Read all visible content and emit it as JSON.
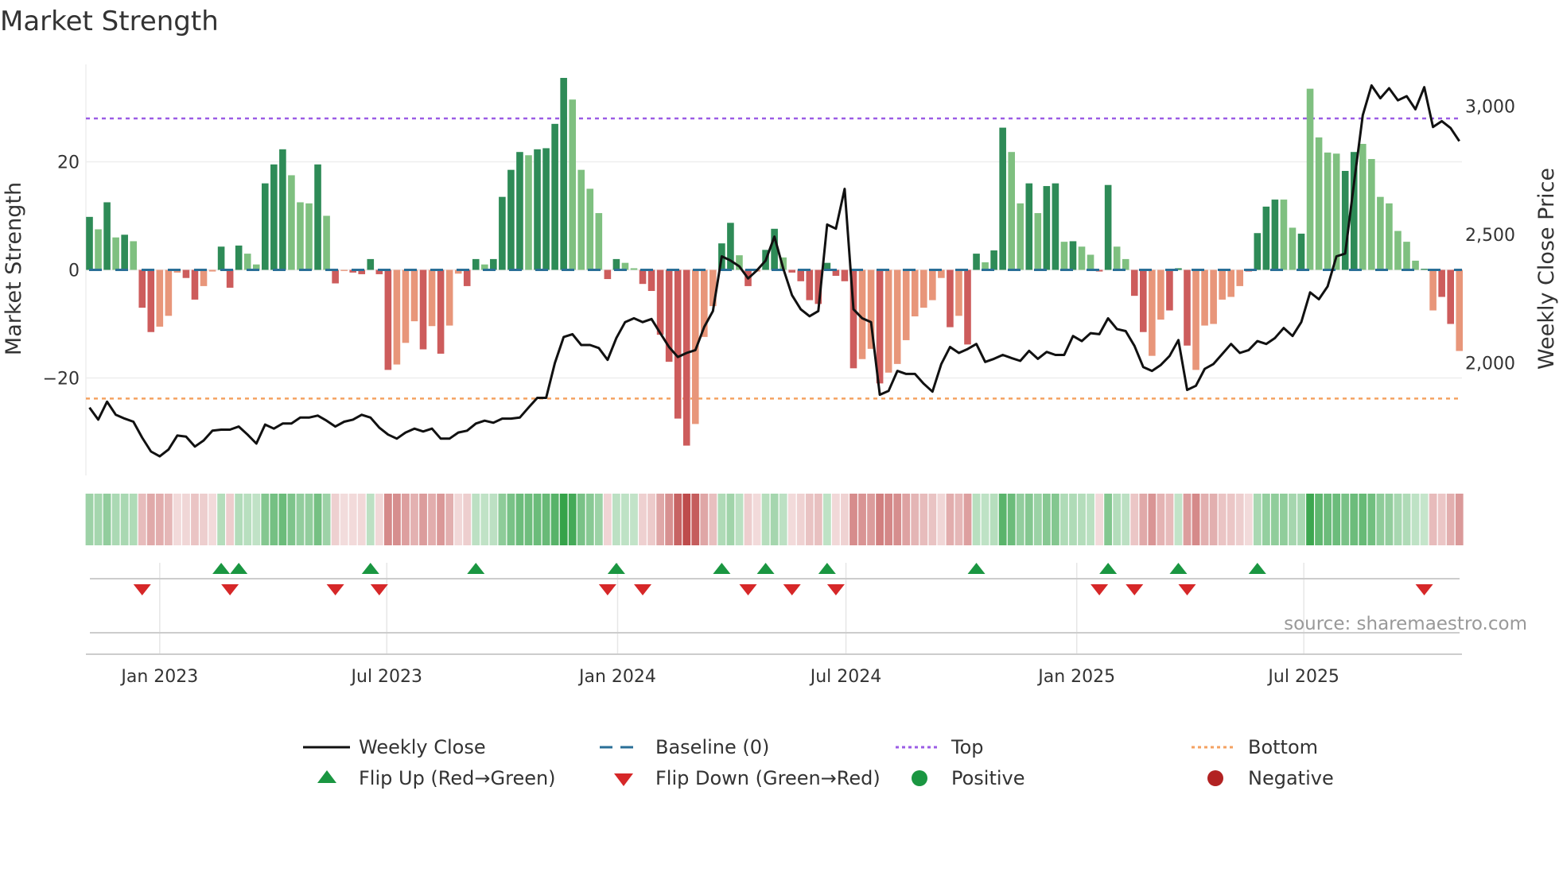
{
  "chart_data": {
    "type": "bar+line",
    "title": "Market Strength",
    "ylabel": "Market Strength",
    "y2label": "Weekly Close Price",
    "ylim": [
      -38,
      38
    ],
    "y2lim": [
      1562,
      3163
    ],
    "start_week": "2022-11-06",
    "frequency": "weekly",
    "yticks": [
      {
        "v": 20,
        "label": "20"
      },
      {
        "v": 0,
        "label": "0"
      },
      {
        "v": -20,
        "label": "−20"
      }
    ],
    "y2ticks": [
      {
        "v": 3000,
        "label": "3,000"
      },
      {
        "v": 2500,
        "label": "2,500"
      },
      {
        "v": 2000,
        "label": "2,000"
      }
    ],
    "xticks": [
      {
        "date": "2023-01-01",
        "label": "Jan 2023"
      },
      {
        "date": "2023-07-01",
        "label": "Jul 2023"
      },
      {
        "date": "2024-01-01",
        "label": "Jan 2024"
      },
      {
        "date": "2024-07-01",
        "label": "Jul 2024"
      },
      {
        "date": "2025-01-01",
        "label": "Jan 2025"
      },
      {
        "date": "2025-07-01",
        "label": "Jul 2025"
      }
    ],
    "top_level": 28,
    "bottom_level": -23.8,
    "grid": true,
    "strength": [
      9.8,
      7.5,
      12.5,
      6,
      6.5,
      5.3,
      -7,
      -11.5,
      -10.5,
      -8.5,
      -0.5,
      -1.5,
      -5.5,
      -3,
      -0.3,
      4.3,
      -3.3,
      4.5,
      3,
      1,
      16,
      19.5,
      22.3,
      17.5,
      12.5,
      12.3,
      19.5,
      10,
      -2.5,
      -0.2,
      -0.5,
      -0.8,
      2,
      -0.8,
      -18.5,
      -17.5,
      -13.5,
      -9.5,
      -14.7,
      -10.4,
      -15.5,
      -10.3,
      -0.7,
      -3,
      2,
      1,
      2,
      13.5,
      18.5,
      21.8,
      21.2,
      22.3,
      22.5,
      27,
      35.5,
      31.5,
      18.5,
      15,
      10.5,
      -1.7,
      2,
      1.3,
      0.3,
      -2.6,
      -3.9,
      -12,
      -17,
      -27.5,
      -32.5,
      -28.5,
      -12.4,
      -6.7,
      4.9,
      8.7,
      2.7,
      -3,
      -0.3,
      3.7,
      7.6,
      2.3,
      -0.5,
      -2.1,
      -5.6,
      -6.3,
      1.3,
      -1.1,
      -2.1,
      -18.2,
      -16.5,
      -14.6,
      -21,
      -19,
      -17.4,
      -13,
      -8.6,
      -7,
      -5.6,
      -1.5,
      -10.6,
      -8.5,
      -13.8,
      3,
      1.4,
      3.6,
      26.3,
      21.8,
      12.3,
      16,
      10.5,
      15.5,
      16,
      5.2,
      5.3,
      4.3,
      2.8,
      -0.3,
      15.7,
      4.3,
      2,
      -4.8,
      -11.5,
      -15.9,
      -9.2,
      -7.5,
      0.3,
      -14,
      -18.5,
      -10.3,
      -10,
      -5.5,
      -5,
      -3,
      -0.3,
      6.8,
      11.7,
      13,
      13,
      7.8,
      6.7,
      33.5,
      24.5,
      21.7,
      21.5,
      18.3,
      21.8,
      23.3,
      20.5,
      13.5,
      12.3,
      7.2,
      5.2,
      1.7,
      0.2,
      -7.5,
      -5,
      -10,
      -15
    ],
    "shade": "dldldlddlllddlldddlldddllldldldddddllldldllddlddddlddddllllddllddddddlllddldlddlddddddddlldllllllldlddlddlldlddldllddllddlldddllllllddddlldllllddllllllldldd",
    "weekly_close": [
      1826,
      1779,
      1849,
      1798,
      1783,
      1771,
      1709,
      1655,
      1636,
      1663,
      1717,
      1713,
      1674,
      1698,
      1736,
      1740,
      1740,
      1752,
      1721,
      1686,
      1760,
      1744,
      1764,
      1764,
      1787,
      1787,
      1795,
      1775,
      1752,
      1771,
      1779,
      1798,
      1787,
      1748,
      1721,
      1705,
      1729,
      1744,
      1733,
      1744,
      1705,
      1705,
      1729,
      1736,
      1764,
      1775,
      1767,
      1783,
      1783,
      1787,
      1826,
      1864,
      1864,
      2000,
      2101,
      2112,
      2070,
      2070,
      2058,
      2012,
      2097,
      2159,
      2174,
      2159,
      2171,
      2116,
      2062,
      2023,
      2039,
      2050,
      2140,
      2202,
      2415,
      2399,
      2376,
      2329,
      2360,
      2399,
      2492,
      2368,
      2264,
      2209,
      2182,
      2202,
      2539,
      2523,
      2678,
      2209,
      2174,
      2159,
      1876,
      1891,
      1969,
      1957,
      1957,
      1919,
      1888,
      1996,
      2062,
      2039,
      2054,
      2074,
      2004,
      2016,
      2031,
      2019,
      2008,
      2047,
      2016,
      2043,
      2031,
      2031,
      2105,
      2085,
      2116,
      2112,
      2174,
      2132,
      2124,
      2066,
      1984,
      1969,
      1992,
      2027,
      2089,
      1895,
      1911,
      1977,
      1996,
      2035,
      2074,
      2039,
      2050,
      2085,
      2074,
      2097,
      2136,
      2105,
      2159,
      2275,
      2248,
      2298,
      2415,
      2426,
      2701,
      2965,
      3081,
      3031,
      3070,
      3023,
      3039,
      2988,
      3074,
      2919,
      2942,
      2915,
      2864
    ],
    "flip_up_weeks": [
      15,
      17,
      32,
      44,
      60,
      72,
      77,
      84,
      101,
      116,
      124,
      133
    ],
    "flip_down_weeks": [
      6,
      16,
      28,
      33,
      59,
      63,
      75,
      80,
      85,
      115,
      119,
      125,
      152
    ],
    "legend": {
      "weekly_close": "Weekly Close",
      "baseline": "Baseline (0)",
      "top": "Top",
      "bottom": "Bottom",
      "flip_up": "Flip Up (Red→Green)",
      "flip_down": "Flip Down (Green→Red)",
      "positive": "Positive",
      "negative": "Negative"
    },
    "legend_placement": "bottom",
    "colors": {
      "pos_dark": "#2e8b57",
      "pos_light": "#7fc080",
      "neg_dark": "#cd5c5c",
      "neg_light": "#e8967a",
      "close": "#111111",
      "baseline": "#2a6f97",
      "top": "#9b5de5",
      "bottom": "#f4a261",
      "flip_up": "#1a9641",
      "flip_down": "#d62728",
      "positive": "#1a9641",
      "negative": "#b22222"
    }
  },
  "source": "source: sharemaestro.com"
}
